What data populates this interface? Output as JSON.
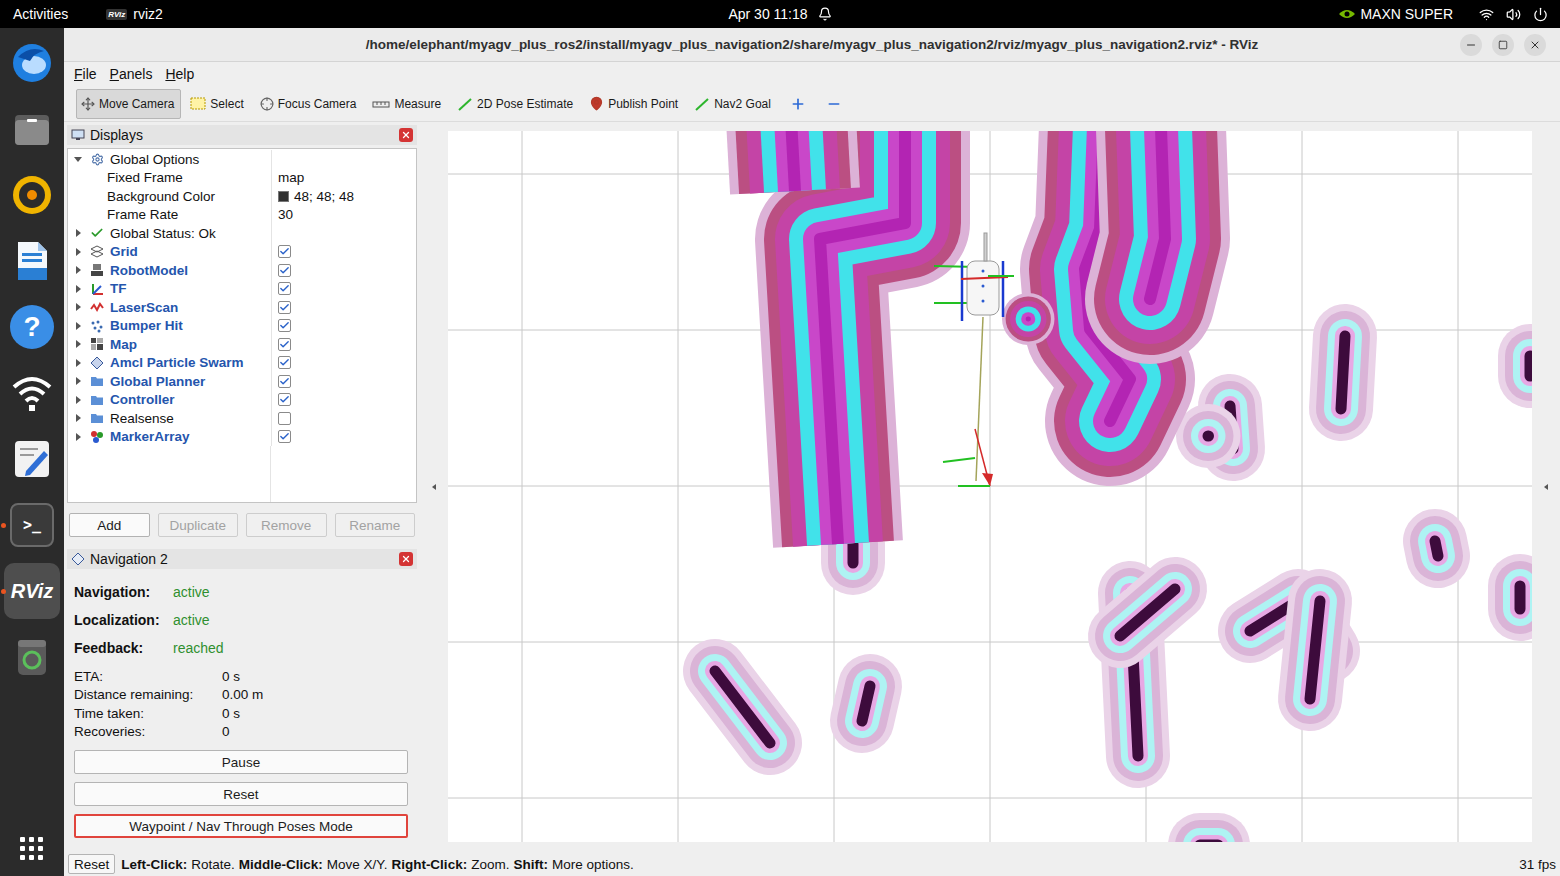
{
  "top_bar": {
    "activities": "Activities",
    "app_icon": "RViz",
    "app": "rviz2",
    "clock": "Apr 30 11:18",
    "power_mode": "MAXN SUPER"
  },
  "dock": {
    "items": [
      {
        "kind": "thunderbird",
        "running": false,
        "selected": false
      },
      {
        "kind": "files",
        "running": false,
        "selected": false
      },
      {
        "kind": "rhythmbox",
        "running": false,
        "selected": false
      },
      {
        "kind": "writer",
        "running": false,
        "selected": false
      },
      {
        "kind": "help",
        "label": "?",
        "running": false,
        "selected": false
      },
      {
        "kind": "network",
        "running": false,
        "selected": false
      },
      {
        "kind": "editor",
        "running": false,
        "selected": false
      },
      {
        "kind": "terminal",
        "label": ">_",
        "running": true,
        "selected": false
      },
      {
        "kind": "rviz",
        "label": "RViz",
        "running": true,
        "selected": true
      },
      {
        "kind": "trash",
        "running": false,
        "selected": false
      }
    ]
  },
  "window": {
    "title": "/home/elephant/myagv_plus_ros2/install/myagv_plus_navigation2/share/myagv_plus_navigation2/rviz/myagv_plus_navigation2.rviz* - RViz",
    "menu": [
      "File",
      "Panels",
      "Help"
    ]
  },
  "toolbar": {
    "tools": [
      {
        "label": "Move Camera",
        "kind": "move",
        "selected": true
      },
      {
        "label": "Select",
        "kind": "select",
        "selected": false
      },
      {
        "label": "Focus Camera",
        "kind": "focus",
        "selected": false
      },
      {
        "label": "Measure",
        "kind": "measure",
        "selected": false
      },
      {
        "label": "2D Pose Estimate",
        "kind": "pose",
        "selected": false
      },
      {
        "label": "Publish Point",
        "kind": "point",
        "selected": false
      },
      {
        "label": "Nav2 Goal",
        "kind": "goal",
        "selected": false
      }
    ]
  },
  "displays": {
    "title": "Displays",
    "global_options": {
      "label": "Global Options",
      "expanded": true,
      "properties": [
        {
          "name": "Fixed Frame",
          "value": "map"
        },
        {
          "name": "Background Color",
          "value": "48; 48; 48",
          "color": "#303030"
        },
        {
          "name": "Frame Rate",
          "value": "30"
        }
      ]
    },
    "global_status": {
      "label": "Global Status: Ok",
      "expanded": false
    },
    "items": [
      {
        "label": "Grid",
        "kind": "grid",
        "checked": true,
        "expanded": false
      },
      {
        "label": "RobotModel",
        "kind": "robot",
        "checked": true,
        "expanded": false
      },
      {
        "label": "TF",
        "kind": "tf",
        "checked": true,
        "expanded": false
      },
      {
        "label": "LaserScan",
        "kind": "laser",
        "checked": true,
        "expanded": false
      },
      {
        "label": "Bumper Hit",
        "kind": "points",
        "checked": true,
        "expanded": false
      },
      {
        "label": "Map",
        "kind": "map",
        "checked": true,
        "expanded": false
      },
      {
        "label": "Amcl Particle Swarm",
        "kind": "particles",
        "checked": true,
        "expanded": false
      },
      {
        "label": "Global Planner",
        "kind": "folder",
        "checked": true,
        "expanded": false
      },
      {
        "label": "Controller",
        "kind": "folder",
        "checked": true,
        "expanded": false
      },
      {
        "label": "Realsense",
        "kind": "folder",
        "checked": false,
        "expanded": false
      },
      {
        "label": "MarkerArray",
        "kind": "markers",
        "checked": true,
        "expanded": false
      }
    ],
    "buttons": [
      {
        "label": "Add",
        "disabled": false
      },
      {
        "label": "Duplicate",
        "disabled": true
      },
      {
        "label": "Remove",
        "disabled": true
      },
      {
        "label": "Rename",
        "disabled": true
      }
    ]
  },
  "navigation": {
    "title": "Navigation 2",
    "status": [
      {
        "label": "Navigation:",
        "value": "active"
      },
      {
        "label": "Localization:",
        "value": "active"
      },
      {
        "label": "Feedback:",
        "value": "reached"
      }
    ],
    "metrics": [
      {
        "label": "ETA:",
        "value": "0 s"
      },
      {
        "label": "Distance remaining:",
        "value": "0.00 m"
      },
      {
        "label": "Time taken:",
        "value": "0 s"
      },
      {
        "label": "Recoveries:",
        "value": "0"
      }
    ],
    "buttons": [
      {
        "label": "Pause",
        "highlighted": false
      },
      {
        "label": "Reset",
        "highlighted": false
      },
      {
        "label": "Waypoint / Nav Through Poses Mode",
        "highlighted": true
      }
    ]
  },
  "status_bar": {
    "reset": "Reset",
    "hint": [
      {
        "text": "Left-Click:",
        "bold": true
      },
      {
        "text": "Rotate.",
        "bold": false
      },
      {
        "text": "Middle-Click:",
        "bold": true
      },
      {
        "text": "Move X/Y.",
        "bold": false
      },
      {
        "text": "Right-Click:",
        "bold": true
      },
      {
        "text": "Zoom.",
        "bold": false
      },
      {
        "text": "Shift:",
        "bold": true
      },
      {
        "text": "More options.",
        "bold": false
      }
    ],
    "fps": "31 fps"
  }
}
